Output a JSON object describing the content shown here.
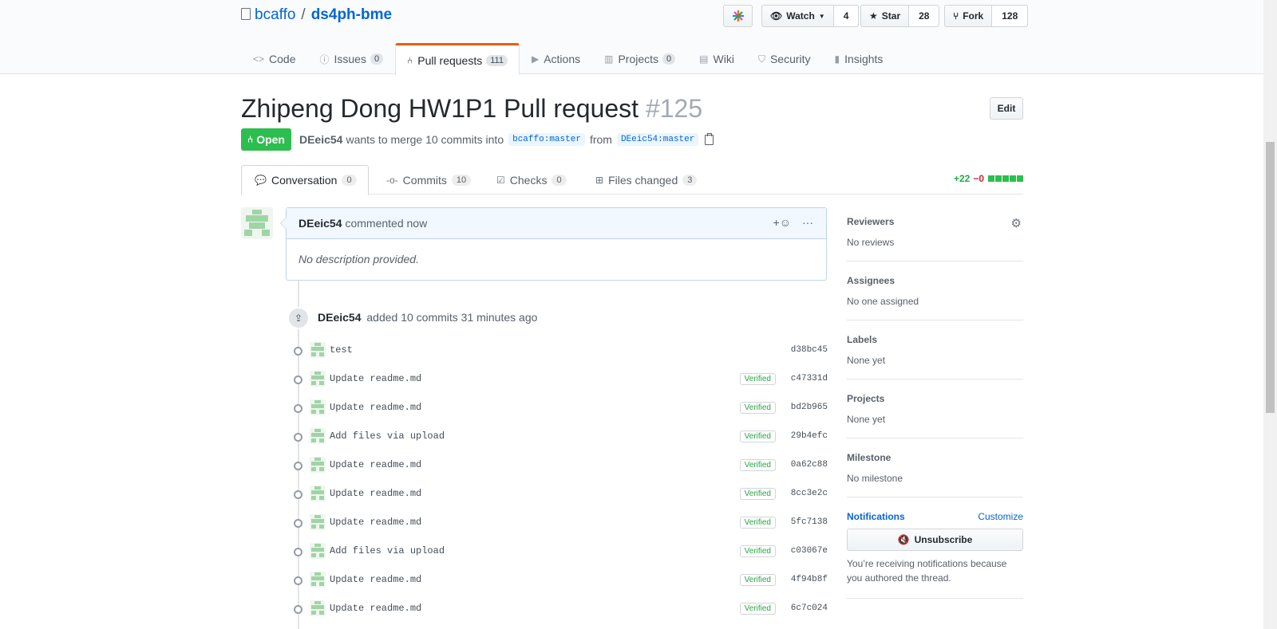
{
  "repo": {
    "owner": "bcaffo",
    "separator": "/",
    "name": "ds4ph-bme"
  },
  "actions": {
    "watch_label": "Watch",
    "watch_count": "4",
    "star_label": "Star",
    "star_count": "28",
    "fork_label": "Fork",
    "fork_count": "128"
  },
  "nav": [
    {
      "label": "Code",
      "icon": "code-icon"
    },
    {
      "label": "Issues",
      "count": "0",
      "icon": "issue-icon"
    },
    {
      "label": "Pull requests",
      "count": "111",
      "icon": "pull-request-icon"
    },
    {
      "label": "Actions",
      "icon": "play-icon"
    },
    {
      "label": "Projects",
      "count": "0",
      "icon": "project-icon"
    },
    {
      "label": "Wiki",
      "icon": "book-icon"
    },
    {
      "label": "Security",
      "icon": "shield-icon"
    },
    {
      "label": "Insights",
      "icon": "graph-icon"
    }
  ],
  "pr": {
    "title": "Zhipeng Dong HW1P1 Pull request",
    "number": "#125",
    "edit_label": "Edit",
    "state": "Open",
    "author": "DEeic54",
    "merge_text": "wants to merge 10 commits into",
    "base_branch": "bcaffo:master",
    "from_text": "from",
    "head_branch": "DEeic54:master"
  },
  "tabs": [
    {
      "label": "Conversation",
      "count": "0"
    },
    {
      "label": "Commits",
      "count": "10"
    },
    {
      "label": "Checks",
      "count": "0"
    },
    {
      "label": "Files changed",
      "count": "3"
    }
  ],
  "diffstat": {
    "additions": "+22",
    "deletions": "−0"
  },
  "comment": {
    "author": "DEeic54",
    "time_text": "commented now",
    "body": "No description provided.",
    "reaction_label": "+",
    "more_label": "···"
  },
  "commit_event": {
    "author": "DEeic54",
    "text": "added 10 commits 31 minutes ago"
  },
  "commits": [
    {
      "message": "test",
      "verified": "",
      "sha": "d38bc45"
    },
    {
      "message": "Update readme.md",
      "verified": "Verified",
      "sha": "c47331d"
    },
    {
      "message": "Update readme.md",
      "verified": "Verified",
      "sha": "bd2b965"
    },
    {
      "message": "Add files via upload",
      "verified": "Verified",
      "sha": "29b4efc"
    },
    {
      "message": "Update readme.md",
      "verified": "Verified",
      "sha": "0a62c88"
    },
    {
      "message": "Update readme.md",
      "verified": "Verified",
      "sha": "8cc3e2c"
    },
    {
      "message": "Update readme.md",
      "verified": "Verified",
      "sha": "5fc7138"
    },
    {
      "message": "Add files via upload",
      "verified": "Verified",
      "sha": "c03067e"
    },
    {
      "message": "Update readme.md",
      "verified": "Verified",
      "sha": "4f94b8f"
    },
    {
      "message": "Update readme.md",
      "verified": "Verified",
      "sha": "6c7c024"
    }
  ],
  "sidebar": {
    "reviewers": {
      "heading": "Reviewers",
      "value": "No reviews"
    },
    "assignees": {
      "heading": "Assignees",
      "value": "No one assigned"
    },
    "labels": {
      "heading": "Labels",
      "value": "None yet"
    },
    "projects": {
      "heading": "Projects",
      "value": "None yet"
    },
    "milestone": {
      "heading": "Milestone",
      "value": "No milestone"
    },
    "notifications": {
      "heading": "Notifications",
      "customize": "Customize",
      "button": "Unsubscribe",
      "reason": "You’re receiving notifications because you authored the thread."
    }
  },
  "colors": {
    "open_green": "#2cbe4e",
    "link_blue": "#0366d6",
    "active_tab": "#e36209"
  }
}
